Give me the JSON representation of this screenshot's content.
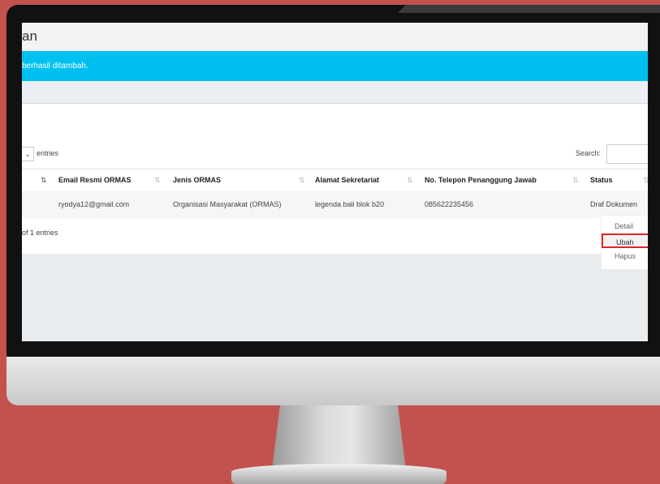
{
  "page": {
    "title": "an",
    "alert_message": "berhasil ditambah."
  },
  "datatable": {
    "length_suffix": "entries",
    "search_label": "Search:",
    "search_value": "",
    "columns": [
      "Email Resmi ORMAS",
      "Jenis ORMAS",
      "Alamat Sekretariat",
      "No. Telepon Penanggung Jawab",
      "Status"
    ],
    "rows": [
      [
        "ryodya12@gmail.com",
        "Organisasi Masyarakat (ORMAS)",
        "legenda bali blok b20",
        "085622235456",
        "Draf Dokumen"
      ]
    ],
    "info": "of 1 entries"
  },
  "action_menu": {
    "items": [
      "Detail",
      "Ubah",
      "Hapus"
    ],
    "highlighted": "Ubah"
  },
  "colors": {
    "background": "#c2524e",
    "alert": "#00c0ef",
    "highlight_border": "#e0262a"
  },
  "icons": [
    "chevron-down-icon",
    "sort-icon",
    "sort-active-icon"
  ]
}
